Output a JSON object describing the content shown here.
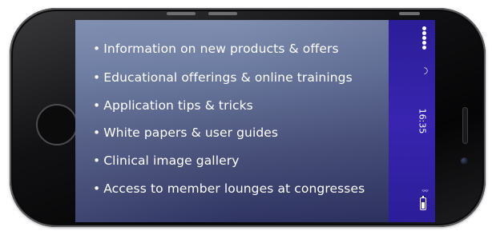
{
  "screen": {
    "features": [
      "Information on new products & offers",
      "Educational offerings & online trainings",
      "Application tips & tricks",
      "White papers & user guides",
      "Clinical image gallery",
      "Access to member lounges at congresses"
    ],
    "bullet": "•"
  },
  "status_bar": {
    "time": "16:35",
    "icons": [
      "signal-dots-icon",
      "wifi-icon",
      "bluetooth-icon",
      "battery-icon"
    ]
  },
  "colors": {
    "status_bar": "#3824b0",
    "screen_top": "#808fb0",
    "screen_bottom": "#2f3462",
    "phone_body": "#111113"
  }
}
